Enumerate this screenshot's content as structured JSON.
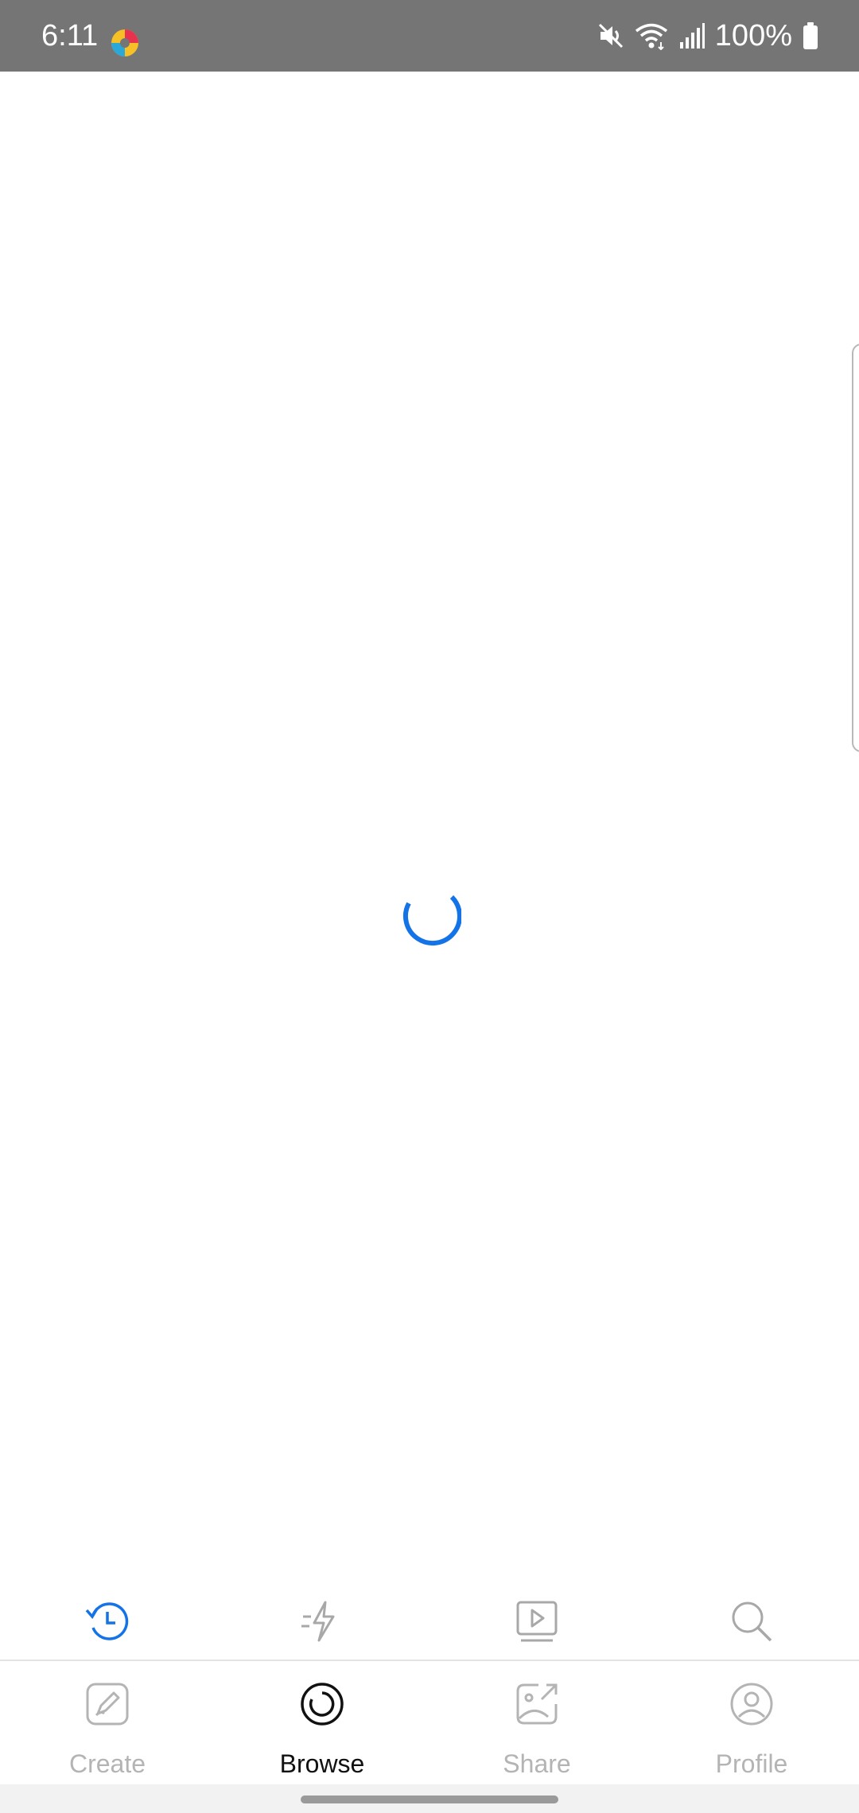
{
  "status_bar": {
    "time": "6:11",
    "battery": "100%",
    "icons": [
      "app-notification-icon",
      "mute-icon",
      "wifi-icon",
      "signal-icon",
      "battery-icon"
    ]
  },
  "main": {
    "loading_indicator": "spinner-icon",
    "accent_color": "#1473e6"
  },
  "sub_tabs": [
    {
      "icon": "history-icon",
      "active": true
    },
    {
      "icon": "lightning-icon",
      "active": false
    },
    {
      "icon": "play-icon",
      "active": false
    },
    {
      "icon": "search-icon",
      "active": false
    }
  ],
  "bottom_nav": {
    "items": [
      {
        "label": "Create",
        "icon": "create-icon",
        "active": false
      },
      {
        "label": "Browse",
        "icon": "browse-icon",
        "active": true
      },
      {
        "label": "Share",
        "icon": "share-icon",
        "active": false
      },
      {
        "label": "Profile",
        "icon": "profile-icon",
        "active": false
      }
    ]
  }
}
